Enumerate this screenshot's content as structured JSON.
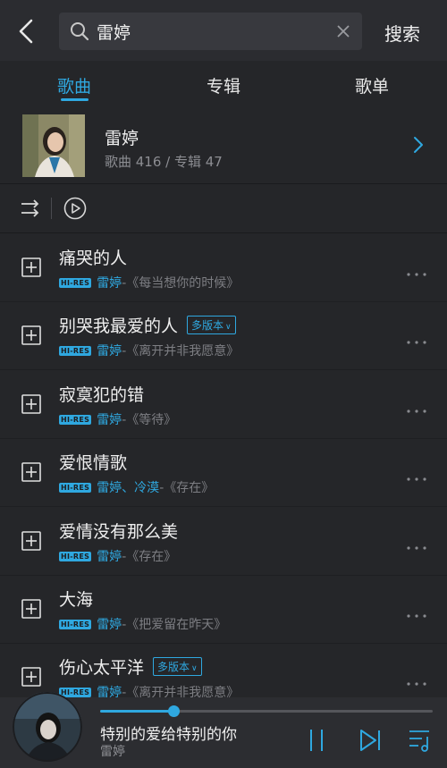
{
  "search": {
    "query": "雷婷",
    "button_label": "搜索"
  },
  "tabs": [
    {
      "label": "歌曲",
      "active": true
    },
    {
      "label": "专辑",
      "active": false
    },
    {
      "label": "歌单",
      "active": false
    }
  ],
  "artist": {
    "name": "雷婷",
    "stats": "歌曲 416 / 专辑 47"
  },
  "songs": [
    {
      "title": "痛哭的人",
      "multi": "",
      "badge": "HI-RES",
      "artist": "雷婷",
      "album": "-《每当想你的时候》"
    },
    {
      "title": "别哭我最爱的人",
      "multi": "多版本",
      "badge": "HI-RES",
      "artist": "雷婷",
      "album": "-《离开并非我愿意》"
    },
    {
      "title": "寂寞犯的错",
      "multi": "",
      "badge": "HI-RES",
      "artist": "雷婷",
      "album": "-《等待》"
    },
    {
      "title": "爱恨情歌",
      "multi": "",
      "badge": "HI-RES",
      "artist": "雷婷、冷漠",
      "album": "-《存在》"
    },
    {
      "title": "爱情没有那么美",
      "multi": "",
      "badge": "HI-RES",
      "artist": "雷婷",
      "album": "-《存在》"
    },
    {
      "title": "大海",
      "multi": "",
      "badge": "HI-RES",
      "artist": "雷婷",
      "album": "-《把爱留在昨天》"
    },
    {
      "title": "伤心太平洋",
      "multi": "多版本",
      "badge": "HI-RES",
      "artist": "雷婷",
      "album": "-《离开并非我愿意》"
    }
  ],
  "player": {
    "title": "特别的爱给特别的你",
    "artist": "雷婷",
    "progress": 0.22
  },
  "colors": {
    "accent": "#2fa8e0",
    "background": "#252629"
  }
}
